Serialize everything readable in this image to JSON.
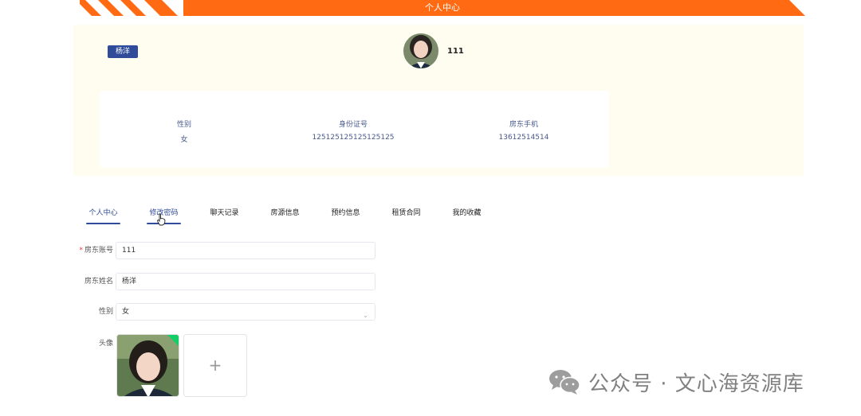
{
  "header": {
    "title": "个人中心"
  },
  "profile": {
    "name_tag": "杨洋",
    "username": "111",
    "info": [
      {
        "label": "性别",
        "value": "女"
      },
      {
        "label": "身份证号",
        "value": "125125125125125125"
      },
      {
        "label": "房东手机",
        "value": "13612514514"
      }
    ]
  },
  "tabs": [
    {
      "label": "个人中心",
      "state": "active"
    },
    {
      "label": "修改密码",
      "state": "hover"
    },
    {
      "label": "聊天记录"
    },
    {
      "label": "房源信息"
    },
    {
      "label": "预约信息"
    },
    {
      "label": "租赁合同"
    },
    {
      "label": "我的收藏"
    }
  ],
  "form": {
    "account": {
      "label": "房东账号",
      "required_mark": "*",
      "value": "111"
    },
    "name": {
      "label": "房东姓名",
      "value": "杨洋"
    },
    "gender": {
      "label": "性别",
      "value": "女"
    },
    "avatar": {
      "label": "头像",
      "upload_glyph": "+"
    }
  },
  "watermark": {
    "text": "公众号 · 文心海资源库",
    "icon": "wechat-icon"
  },
  "colors": {
    "banner": "#ff6a13",
    "accent": "#2f4b9a",
    "panel": "#fffdf0",
    "success": "#13ce66"
  }
}
